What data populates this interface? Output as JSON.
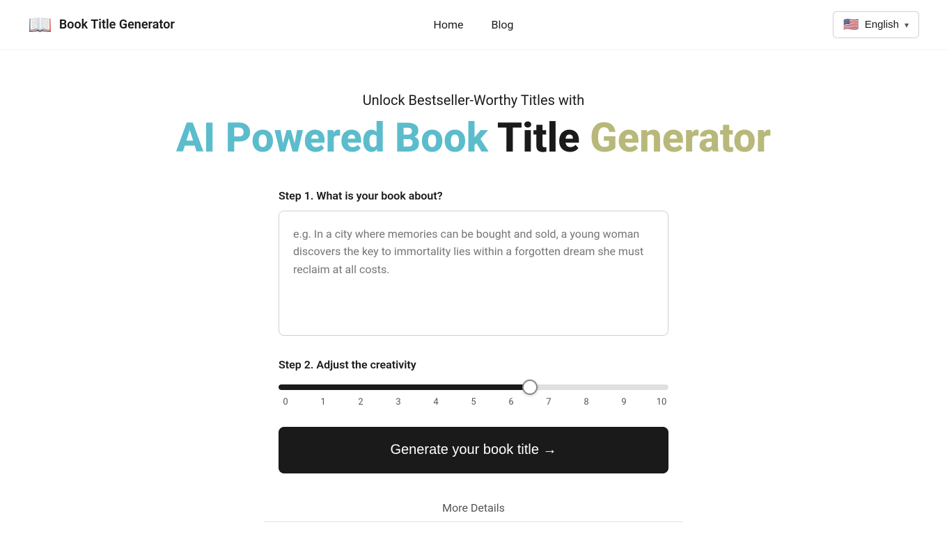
{
  "navbar": {
    "brand_icon": "📖",
    "brand_name": "Book Title Generator",
    "nav_items": [
      {
        "label": "Home",
        "href": "#"
      },
      {
        "label": "Blog",
        "href": "#"
      }
    ],
    "lang": {
      "flag": "🇺🇸",
      "label": "English",
      "chevron": "▾"
    }
  },
  "hero": {
    "subtitle": "Unlock Bestseller-Worthy Titles with",
    "title_parts": {
      "ai": "AI",
      "powered": " Powered ",
      "book": "Book ",
      "title_word": "Title ",
      "generator": "Generator"
    }
  },
  "step1": {
    "label": "Step 1. What is your book about?",
    "placeholder": "e.g. In a city where memories can be bought and sold, a young woman discovers the key to immortality lies within a forgotten dream she must reclaim at all costs."
  },
  "step2": {
    "label": "Step 2. Adjust the creativity",
    "slider": {
      "min": 0,
      "max": 10,
      "value": 6.5,
      "labels": [
        "0",
        "1",
        "2",
        "3",
        "4",
        "5",
        "6",
        "7",
        "8",
        "9",
        "10"
      ]
    }
  },
  "generate_button": {
    "label": "Generate your book title →"
  },
  "more_details": {
    "label": "More Details"
  }
}
